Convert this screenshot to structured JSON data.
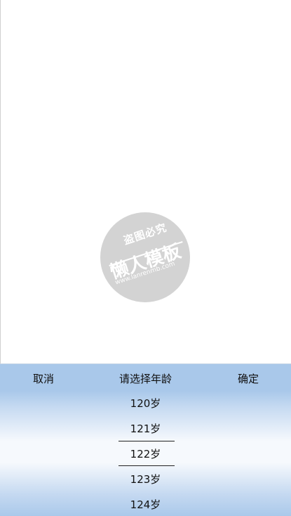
{
  "watermark": {
    "top_text": "盗图必究",
    "main_text": "懒人模板",
    "url_text": "www.lanrenmb.com"
  },
  "picker": {
    "cancel_label": "取消",
    "title": "请选择年龄",
    "confirm_label": "确定",
    "options": [
      "120岁",
      "121岁",
      "122岁",
      "123岁",
      "124岁"
    ],
    "selected": "122岁"
  },
  "colors": {
    "picker_blue": "#a9c8ea",
    "picker_center": "#f6f9fd",
    "watermark": "#d3d3d3"
  }
}
